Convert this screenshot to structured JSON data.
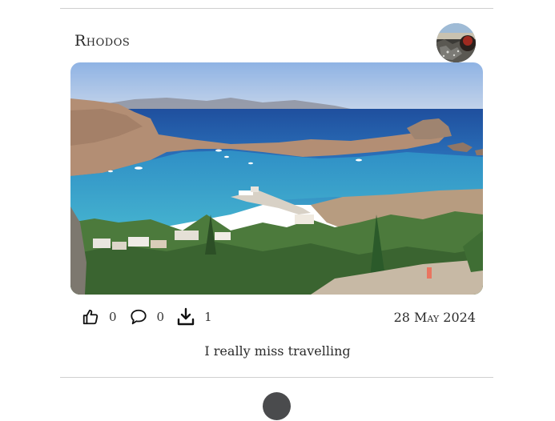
{
  "post": {
    "title": "Rhodos",
    "date": "28 May 2024",
    "caption": "I really miss travelling",
    "likes": "0",
    "comments": "0",
    "downloads": "1",
    "image_alt": "Lindos bay, Rhodes"
  },
  "icons": {
    "like": "thumbs-up-icon",
    "comment": "comment-icon",
    "download": "download-icon"
  },
  "colors": {
    "divider": "#cfcfcf",
    "text": "#2a2a2a",
    "next_avatar": "#4a4b4d"
  }
}
